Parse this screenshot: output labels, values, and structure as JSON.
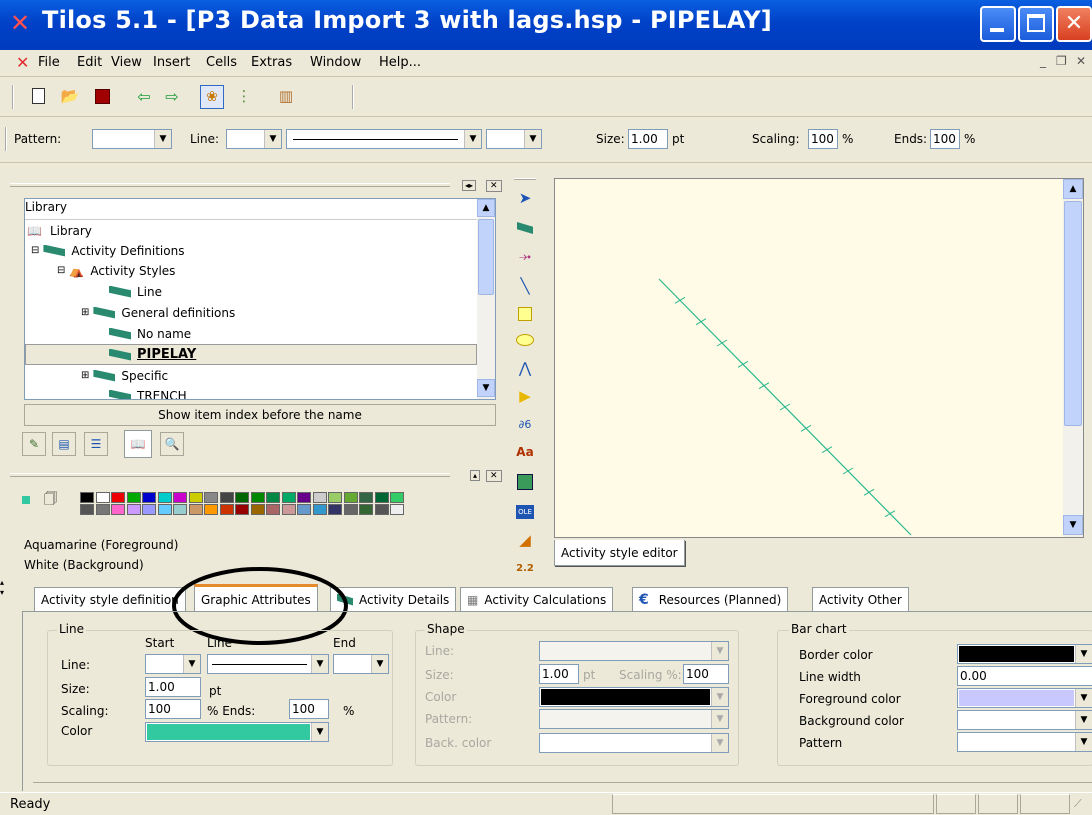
{
  "app": {
    "title": "Tilos 5.1   - [P3 Data Import 3 with lags.hsp -  PIPELAY]"
  },
  "menu": [
    "File",
    "Edit",
    "View",
    "Insert",
    "Cells",
    "Extras",
    "Window",
    "Help..."
  ],
  "style_toolbar": {
    "pattern_label": "Pattern:",
    "line_label": "Line:",
    "size_label": "Size:",
    "size_value": "1.00",
    "size_unit": "pt",
    "scaling_label": "Scaling:",
    "scaling_value": "100",
    "scaling_unit": "%",
    "ends_label": "Ends:",
    "ends_value": "100",
    "ends_unit": "%"
  },
  "library": {
    "header": "Library",
    "items": [
      {
        "label": "Library",
        "level": 0
      },
      {
        "label": "Activity Definitions",
        "level": 1
      },
      {
        "label": "Activity Styles",
        "level": 2
      },
      {
        "label": "Line",
        "level": 3
      },
      {
        "label": "General definitions",
        "level": 3
      },
      {
        "label": "No name",
        "level": 3
      },
      {
        "label": "PIPELAY",
        "level": 3,
        "selected": true
      },
      {
        "label": "Specific",
        "level": 3
      },
      {
        "label": "TRENCH",
        "level": 3
      }
    ],
    "footer_button": "Show item index before the name"
  },
  "palette": {
    "foreground_label": "Aquamarine (Foreground)",
    "background_label": "White (Background)"
  },
  "editor": {
    "tab_label": "Activity style editor",
    "line_color": "#2ab890",
    "canvas_bg": "#fffbe6"
  },
  "tabs": [
    {
      "label": "Activity style definition"
    },
    {
      "label": "Graphic Attributes",
      "active": true
    },
    {
      "label": "Activity Details"
    },
    {
      "label": "Activity Calculations"
    },
    {
      "label": "Resources (Planned)"
    },
    {
      "label": "Activity Other"
    }
  ],
  "line_group": {
    "title": "Line",
    "start_label": "Start",
    "line_col_label": "Line",
    "end_label": "End",
    "line_label": "Line:",
    "size_label": "Size:",
    "size_value": "1.00",
    "size_unit": "pt",
    "scaling_label": "Scaling:",
    "scaling_value": "100",
    "ends_label": "% Ends:",
    "ends_value": "100",
    "ends_unit": "%",
    "color_label": "Color",
    "color": "#33c9a0"
  },
  "shape_group": {
    "title": "Shape",
    "line_label": "Line:",
    "size_label": "Size:",
    "size_value": "1.00",
    "size_unit": "pt",
    "scaling_label": "Scaling %:",
    "scaling_value": "100",
    "color_label": "Color",
    "pattern_label": "Pattern:",
    "back_color_label": "Back. color"
  },
  "bar_group": {
    "title": "Bar chart",
    "border_color_label": "Border color",
    "line_width_label": "Line width",
    "line_width_value": "0.00",
    "fg_color_label": "Foreground color",
    "bg_color_label": "Background color",
    "pattern_label": "Pattern",
    "fg_color": "#c8c8ff"
  },
  "status": {
    "text": "Ready"
  }
}
